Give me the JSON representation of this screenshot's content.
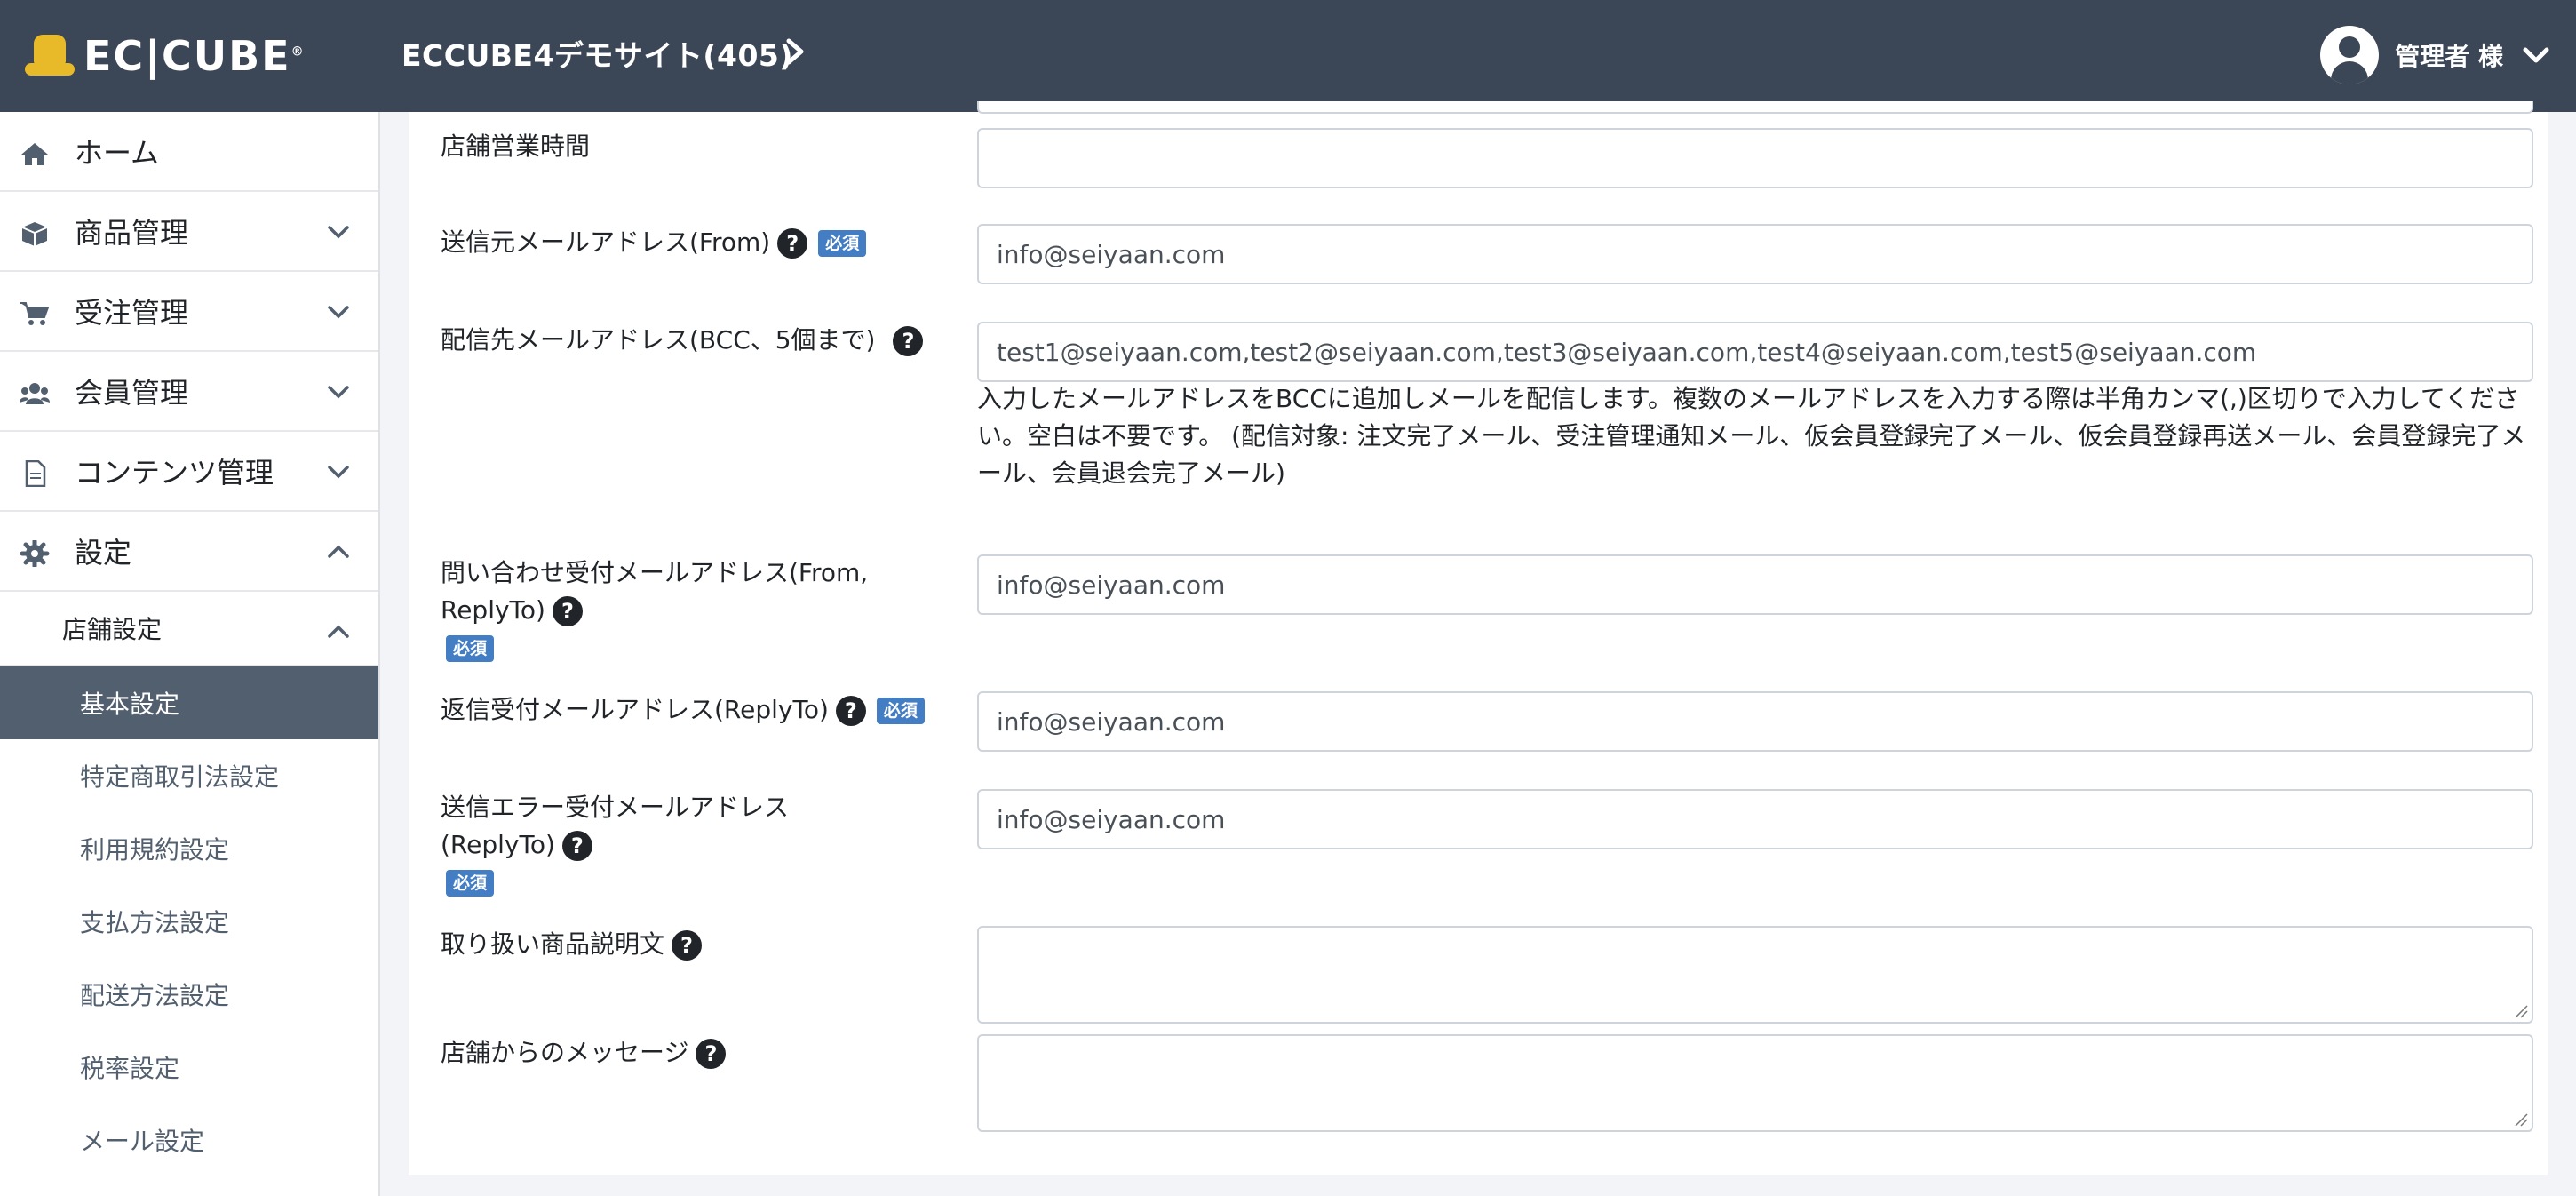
{
  "header": {
    "logo_text": "EC|CUBE",
    "site_title": "ECCUBE4デモサイト(405)",
    "user_name": "管理者 様"
  },
  "sidebar": {
    "items": [
      {
        "label": "ホーム",
        "icon": "home-icon"
      },
      {
        "label": "商品管理",
        "icon": "box-icon"
      },
      {
        "label": "受注管理",
        "icon": "cart-icon"
      },
      {
        "label": "会員管理",
        "icon": "users-icon"
      },
      {
        "label": "コンテンツ管理",
        "icon": "file-icon"
      },
      {
        "label": "設定",
        "icon": "gear-icon"
      }
    ],
    "sub": {
      "label": "店舗設定"
    },
    "leaves": [
      "基本設定",
      "特定商取引法設定",
      "利用規約設定",
      "支払方法設定",
      "配送方法設定",
      "税率設定",
      "メール設定"
    ]
  },
  "form": {
    "business_hours": {
      "label": "店舗営業時間",
      "value": ""
    },
    "email_from": {
      "label": "送信元メールアドレス(From)",
      "value": "info@seiyaan.com"
    },
    "bcc": {
      "label": "配信先メールアドレス(BCC、5個まで)",
      "value": "test1@seiyaan.com,test2@seiyaan.com,test3@seiyaan.com,test4@seiyaan.com,test5@seiyaan.com",
      "help_line1": "入力したメールアドレスをBCCに追加しメールを配信します。複数のメールアドレスを入力する際は半角カンマ(,)区切りで入力してくださ",
      "help_line2": "い。空白は不要です。 (配信対象: 注文完了メール、受注管理通知メール、仮会員登録完了メール、仮会員登録再送メール、会員登録完了メ",
      "help_line3": "ール、会員退会完了メール)"
    },
    "inquiry": {
      "label_line1": "問い合わせ受付メールアドレス(From,",
      "label_line2": "ReplyTo)",
      "value": "info@seiyaan.com"
    },
    "reply_to": {
      "label": "返信受付メールアドレス(ReplyTo)",
      "value": "info@seiyaan.com"
    },
    "return_path": {
      "label_line1": "送信エラー受付メールアドレス",
      "label_line2": "(ReplyTo)",
      "value": "info@seiyaan.com"
    },
    "product_desc": {
      "label": "取り扱い商品説明文",
      "value": ""
    },
    "shop_message": {
      "label": "店舗からのメッセージ",
      "value": ""
    },
    "required_badge": "必須",
    "help_glyph": "?"
  },
  "colors": {
    "header_bg": "#3b4656",
    "active_nav_bg": "#525f6e",
    "required_badge": "#437ec4",
    "logo_yellow": "#e8b928"
  }
}
